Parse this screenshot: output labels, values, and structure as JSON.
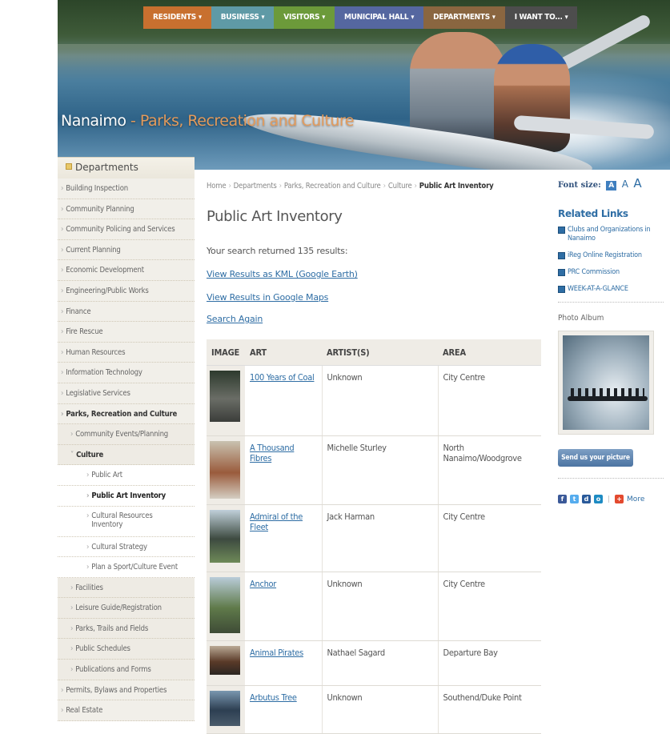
{
  "site": {
    "title_main": "Nanaimo",
    "title_sep": " - ",
    "title_sub": "Parks, Recreation and Culture"
  },
  "topnav": [
    {
      "label": "RESIDENTS",
      "color": "#c8702f"
    },
    {
      "label": "BUSINESS",
      "color": "#5f9aa6"
    },
    {
      "label": "VISITORS",
      "color": "#6c9a3a"
    },
    {
      "label": "MUNICIPAL HALL",
      "color": "#5567a0"
    },
    {
      "label": "DEPARTMENTS",
      "color": "#8a6640"
    },
    {
      "label": "I WANT TO...",
      "color": "#4d4d4d"
    }
  ],
  "sidebar": {
    "header": "Departments",
    "items": [
      {
        "label": "Building Inspection",
        "level": 1
      },
      {
        "label": "Community Planning",
        "level": 1
      },
      {
        "label": "Community Policing and Services",
        "level": 1
      },
      {
        "label": "Current Planning",
        "level": 1
      },
      {
        "label": "Economic Development",
        "level": 1
      },
      {
        "label": "Engineering/Public Works",
        "level": 1
      },
      {
        "label": "Finance",
        "level": 1
      },
      {
        "label": "Fire Rescue",
        "level": 1
      },
      {
        "label": "Human Resources",
        "level": 1
      },
      {
        "label": "Information Technology",
        "level": 1
      },
      {
        "label": "Legislative Services",
        "level": 1
      },
      {
        "label": "Parks, Recreation and Culture",
        "level": 1,
        "active": true
      },
      {
        "label": "Community Events/Planning",
        "level": 2
      },
      {
        "label": "Culture",
        "level": 2,
        "active": true
      },
      {
        "label": "Public Art",
        "level": 3
      },
      {
        "label": "Public Art Inventory",
        "level": 3,
        "active": true
      },
      {
        "label": "Cultural Resources Inventory",
        "level": 3,
        "tall": true
      },
      {
        "label": "Cultural Strategy",
        "level": 3
      },
      {
        "label": "Plan a Sport/Culture Event",
        "level": 3
      },
      {
        "label": "Facilities",
        "level": 2
      },
      {
        "label": "Leisure Guide/Registration",
        "level": 2
      },
      {
        "label": "Parks, Trails and Fields",
        "level": 2
      },
      {
        "label": "Public Schedules",
        "level": 2
      },
      {
        "label": "Publications and Forms",
        "level": 2
      },
      {
        "label": "Permits, Bylaws and Properties",
        "level": 1
      },
      {
        "label": "Real Estate",
        "level": 1
      }
    ]
  },
  "breadcrumb": {
    "items": [
      "Home",
      "Departments",
      "Parks, Recreation and Culture",
      "Culture"
    ],
    "current": "Public Art Inventory"
  },
  "main": {
    "title": "Public Art Inventory",
    "result_text": "Your search returned 135 results:",
    "kml_link": "View Results as KML (Google Earth)",
    "gmaps_link": "View Results in Google Maps",
    "search_again": "Search Again"
  },
  "table": {
    "headers": [
      "IMAGE",
      "ART",
      "ARTIST(S)",
      "AREA"
    ],
    "rows": [
      {
        "art": [
          "100 Years of Coal"
        ],
        "artist": [
          "Unknown"
        ],
        "area": [
          "City Centre"
        ]
      },
      {
        "art": [
          "A Thousand",
          "Fibres"
        ],
        "artist": [
          "Michelle Sturley"
        ],
        "area": [
          "North",
          "Nanaimo/Woodgrove"
        ]
      },
      {
        "art": [
          "Admiral of the",
          "Fleet"
        ],
        "artist": [
          "Jack Harman"
        ],
        "area": [
          "City Centre"
        ]
      },
      {
        "art": [
          "Anchor"
        ],
        "artist": [
          "Unknown"
        ],
        "area": [
          "City Centre"
        ]
      },
      {
        "art": [
          "Animal Pirates"
        ],
        "artist": [
          "Nathael Sagard"
        ],
        "area": [
          "Departure Bay"
        ]
      },
      {
        "art": [
          "Arbutus Tree"
        ],
        "artist": [
          "Unknown"
        ],
        "area": [
          "Southend/Duke Point"
        ]
      }
    ]
  },
  "right": {
    "font_size_label": "Font size:",
    "font_sizes": [
      "A",
      "A",
      "A"
    ],
    "related_title": "Related Links",
    "related_links": [
      "Clubs and Organizations in Nanaimo",
      "iReg Online Registration",
      "PRC Commission",
      "WEEK-AT-A-GLANCE"
    ],
    "photo_album_title": "Photo Album",
    "send_button": "Send us your picture",
    "social_more": "More"
  },
  "colors": {
    "link": "#2e6da4",
    "sidebar_bg": "#f1efe9",
    "table_header_bg": "#efece6"
  }
}
